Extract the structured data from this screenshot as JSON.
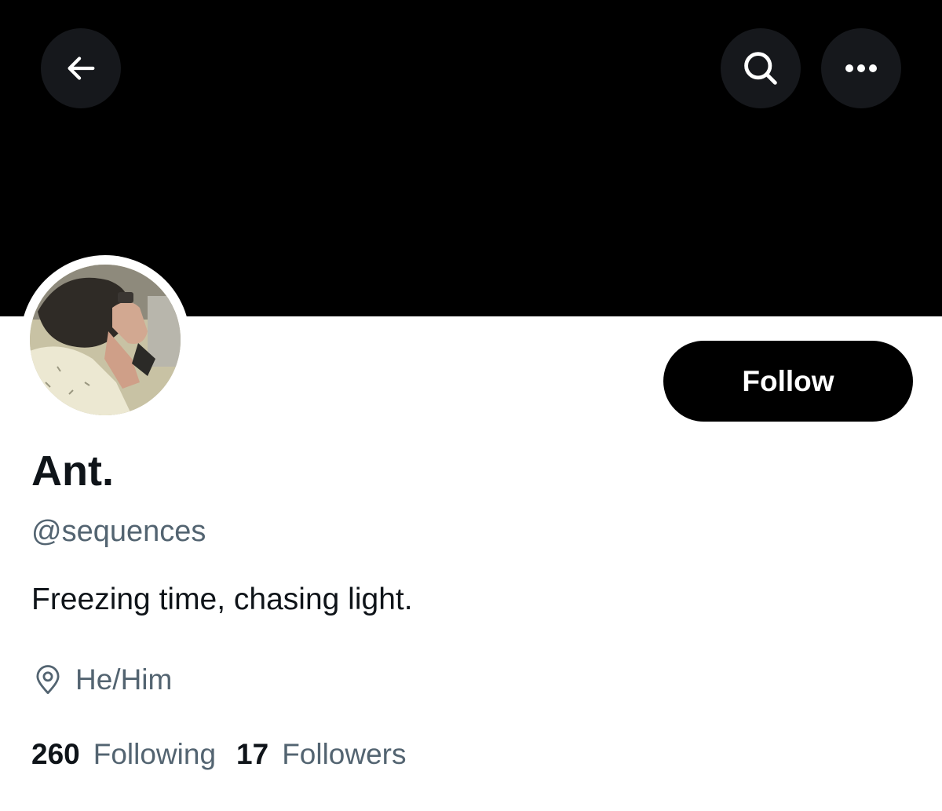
{
  "header": {
    "back_icon": "arrow-left-icon",
    "search_icon": "search-icon",
    "more_icon": "more-horizontal-icon",
    "banner_color": "#000000"
  },
  "profile": {
    "display_name": "Ant.",
    "handle": "@sequences",
    "bio": "Freezing time, chasing light.",
    "location_icon": "location-pin-icon",
    "location": "He/Him"
  },
  "actions": {
    "follow_label": "Follow"
  },
  "stats": {
    "following_count": "260",
    "following_label": "Following",
    "followers_count": "17",
    "followers_label": "Followers"
  }
}
